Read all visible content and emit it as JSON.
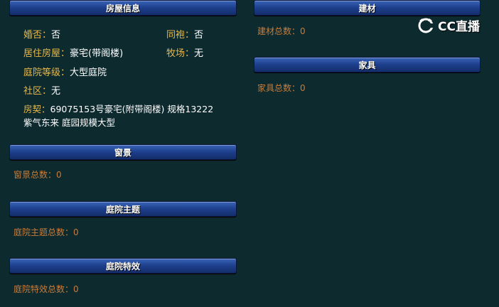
{
  "sections": {
    "house_info": {
      "title": "房屋信息",
      "married_label": "婚否",
      "married_value": "否",
      "sibling_label": "同袍",
      "sibling_value": "否",
      "residence_label": "居住房屋",
      "residence_value": "豪宅(带阁楼)",
      "ranch_label": "牧场",
      "ranch_value": "无",
      "yard_level_label": "庭院等级",
      "yard_level_value": "大型庭院",
      "community_label": "社区",
      "community_value": "无",
      "deed_label": "房契",
      "deed_line1": "69075153号豪宅(附带阁楼) 规格13222",
      "deed_line2": "紫气东来 庭园规模大型"
    },
    "window_view": {
      "title": "窗景",
      "count_text": "窗景总数：0"
    },
    "yard_theme": {
      "title": "庭院主题",
      "count_text": "庭院主题总数：0"
    },
    "yard_effect": {
      "title": "庭院特效",
      "count_text": "庭院特效总数：0"
    },
    "materials": {
      "title": "建材",
      "count_text": "建材总数：0"
    },
    "furniture": {
      "title": "家具",
      "count_text": "家具总数：0"
    }
  },
  "watermark": {
    "text": "CC直播",
    "icon": "cc-live-logo-icon"
  },
  "colors": {
    "background": "#0d2a2f",
    "label": "#e8b84a",
    "count": "#c87c3a",
    "bar": "#1d3f8c"
  }
}
